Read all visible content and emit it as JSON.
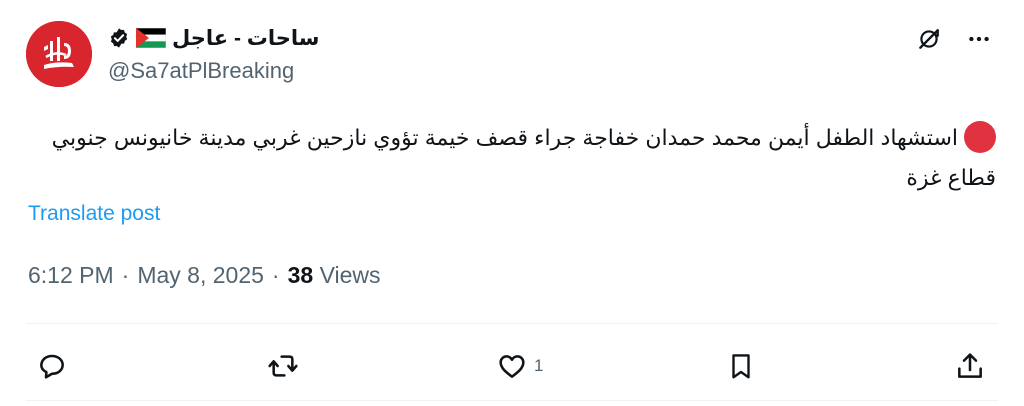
{
  "author": {
    "display_name": "ساحات - عاجل",
    "handle": "@Sa7atPlBreaking",
    "verified": true,
    "flag": "palestine-flag-icon",
    "avatar": "sahat-logo-avatar"
  },
  "tweet": {
    "text": "استشهاد الطفل أيمن محمد حمدان خفاجة جراء قصف خيمة تؤوي نازحين غربي مدينة خانيونس جنوبي قطاع غزة",
    "leading_emoji": "red-circle-icon",
    "translate_label": "Translate post",
    "time": "6:12 PM",
    "date": "May 8, 2025",
    "views_count": "38",
    "views_label": "Views"
  },
  "actions": {
    "reply_icon": "reply-icon",
    "repost_icon": "repost-icon",
    "like_icon": "like-icon",
    "like_count": "1",
    "bookmark_icon": "bookmark-icon",
    "share_icon": "share-icon"
  },
  "top_actions": {
    "grok_icon": "grok-icon",
    "more_icon": "more-icon"
  },
  "colors": {
    "text": "#0f1419",
    "secondary": "#536471",
    "link": "#1d9bf0",
    "avatar_red": "#d9262e",
    "divider": "#eff3f4"
  }
}
